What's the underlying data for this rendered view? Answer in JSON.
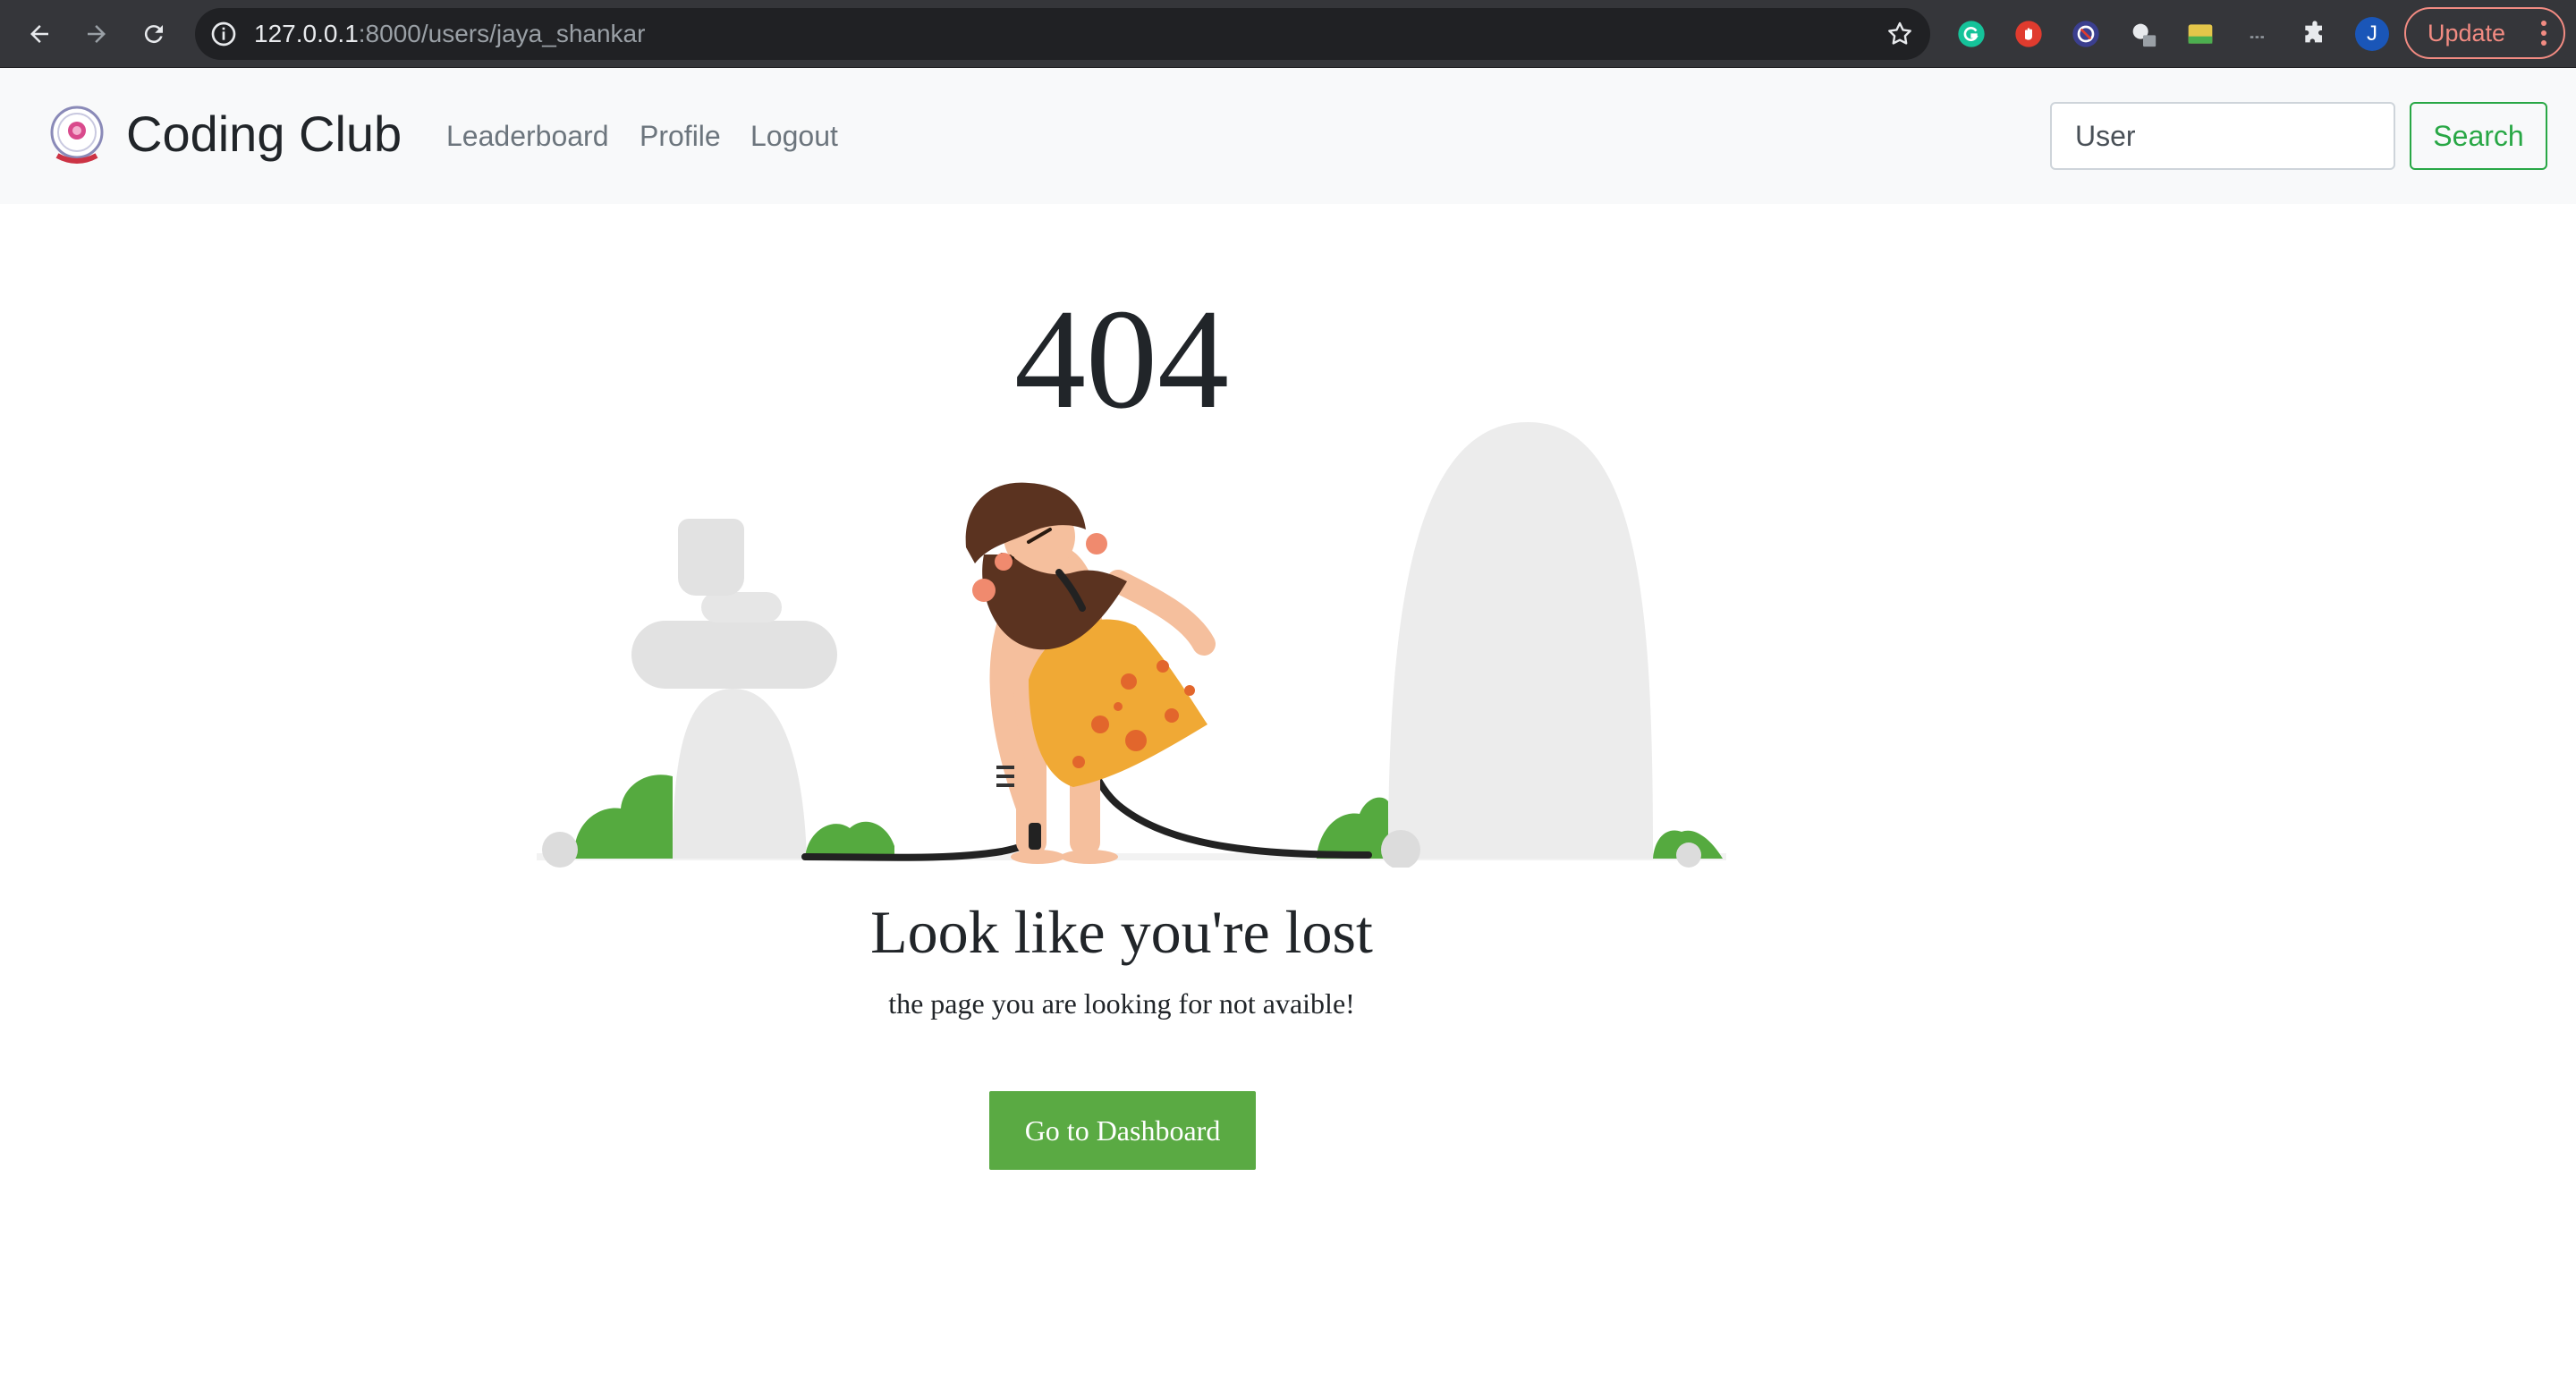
{
  "browser": {
    "url_host": "127.0.0.1",
    "url_rest": ":8000/users/jaya_shankar",
    "update_label": "Update",
    "profile_initial": "J",
    "colors": {
      "chrome_bg": "#35363a",
      "omnibox_bg": "#202124",
      "update_accent": "#f28b82"
    },
    "icons": [
      "back-icon",
      "forward-icon",
      "reload-icon",
      "info-icon",
      "star-icon",
      "grammarly-icon",
      "extension-red-icon",
      "extension-blocker-icon",
      "extension-cloud-icon",
      "extension-image-icon",
      "extension-more-icon",
      "puzzle-icon",
      "profile-avatar",
      "kebab-menu-icon"
    ]
  },
  "navbar": {
    "brand": "Coding Club",
    "links": [
      {
        "label": "Leaderboard"
      },
      {
        "label": "Profile"
      },
      {
        "label": "Logout"
      }
    ],
    "search_placeholder": "User",
    "search_button": "Search",
    "colors": {
      "navbar_bg": "#f8f9fa",
      "search_accent": "#28a745"
    }
  },
  "error_page": {
    "code": "404",
    "heading": "Look like you're lost",
    "subtext": "the page you are looking for not avaible!",
    "button_label": "Go to Dashboard",
    "colors": {
      "button_bg": "#5aaa43",
      "bush_green": "#55aa3f",
      "rock_gray": "#e8e8e8"
    }
  }
}
